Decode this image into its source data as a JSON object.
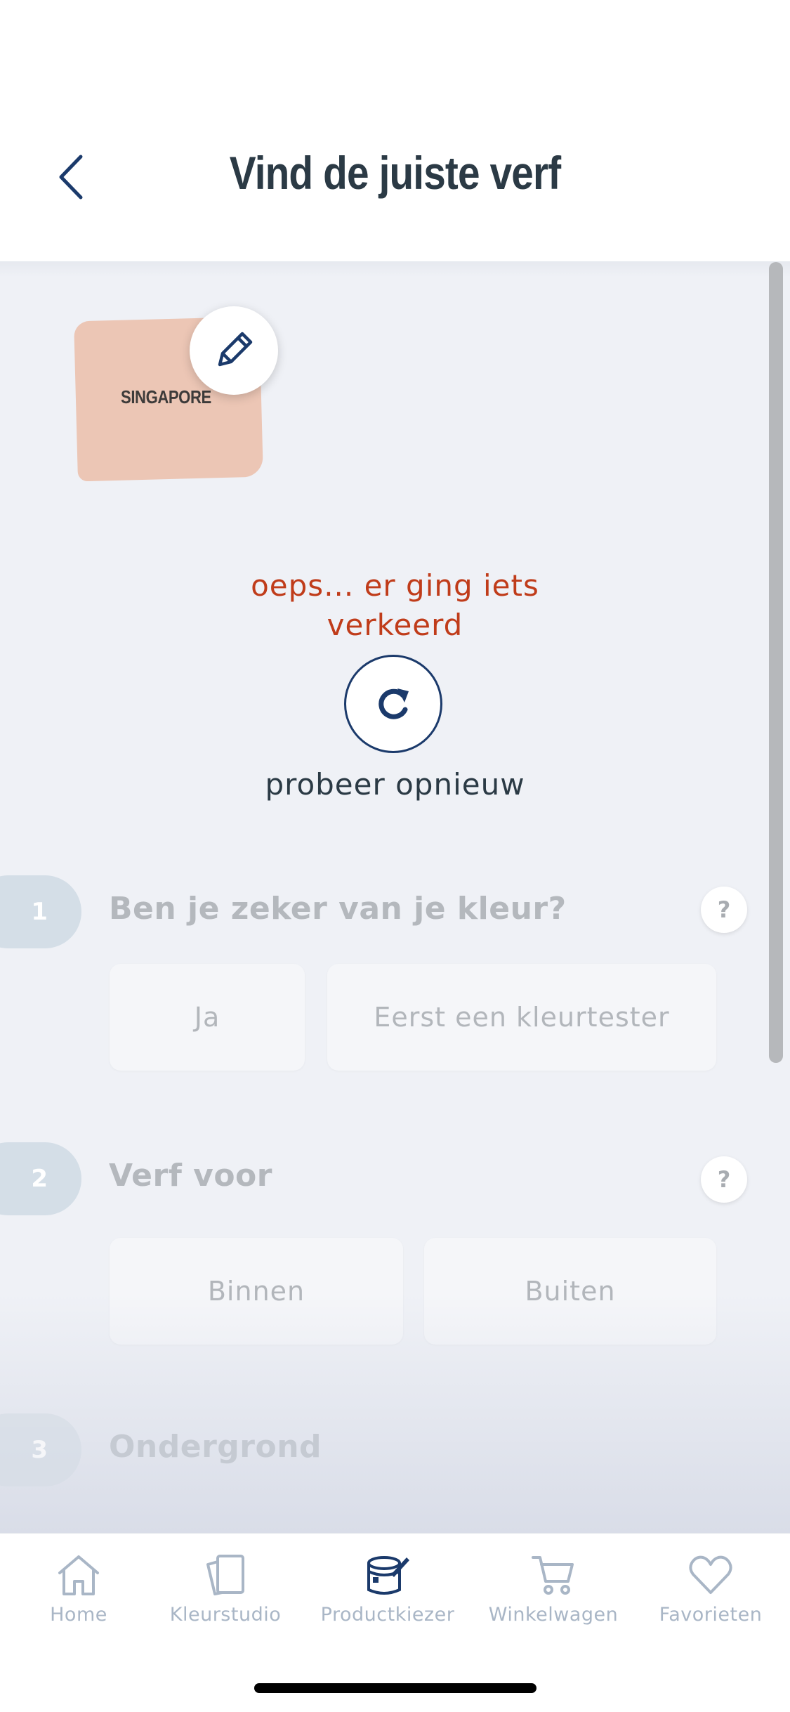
{
  "header": {
    "title": "Vind de juiste verf"
  },
  "color": {
    "name": "SINGAPORE",
    "swatch_hex": "#ecc6b5"
  },
  "error": {
    "line1": "oeps... er ging iets",
    "line2": "verkeerd",
    "retry_label": "probeer opnieuw"
  },
  "steps": [
    {
      "number": "1",
      "title": "Ben je zeker van je kleur?",
      "help": "?",
      "options": [
        "Ja",
        "Eerst een kleurtester"
      ]
    },
    {
      "number": "2",
      "title": "Verf voor",
      "help": "?",
      "options": [
        "Binnen",
        "Buiten"
      ]
    },
    {
      "number": "3",
      "title": "Ondergrond"
    }
  ],
  "tabbar": {
    "items": [
      {
        "label": "Home",
        "icon": "home-icon"
      },
      {
        "label": "Kleurstudio",
        "icon": "color-cards-icon"
      },
      {
        "label": "Productkiezer",
        "icon": "paint-can-icon",
        "active": true
      },
      {
        "label": "Winkelwagen",
        "icon": "cart-icon"
      },
      {
        "label": "Favorieten",
        "icon": "heart-icon"
      }
    ]
  },
  "colors": {
    "accent": "#1b3a6b",
    "error": "#c03c1a",
    "inactive_tab": "#a9b6c6",
    "background": "#eff1f6"
  }
}
